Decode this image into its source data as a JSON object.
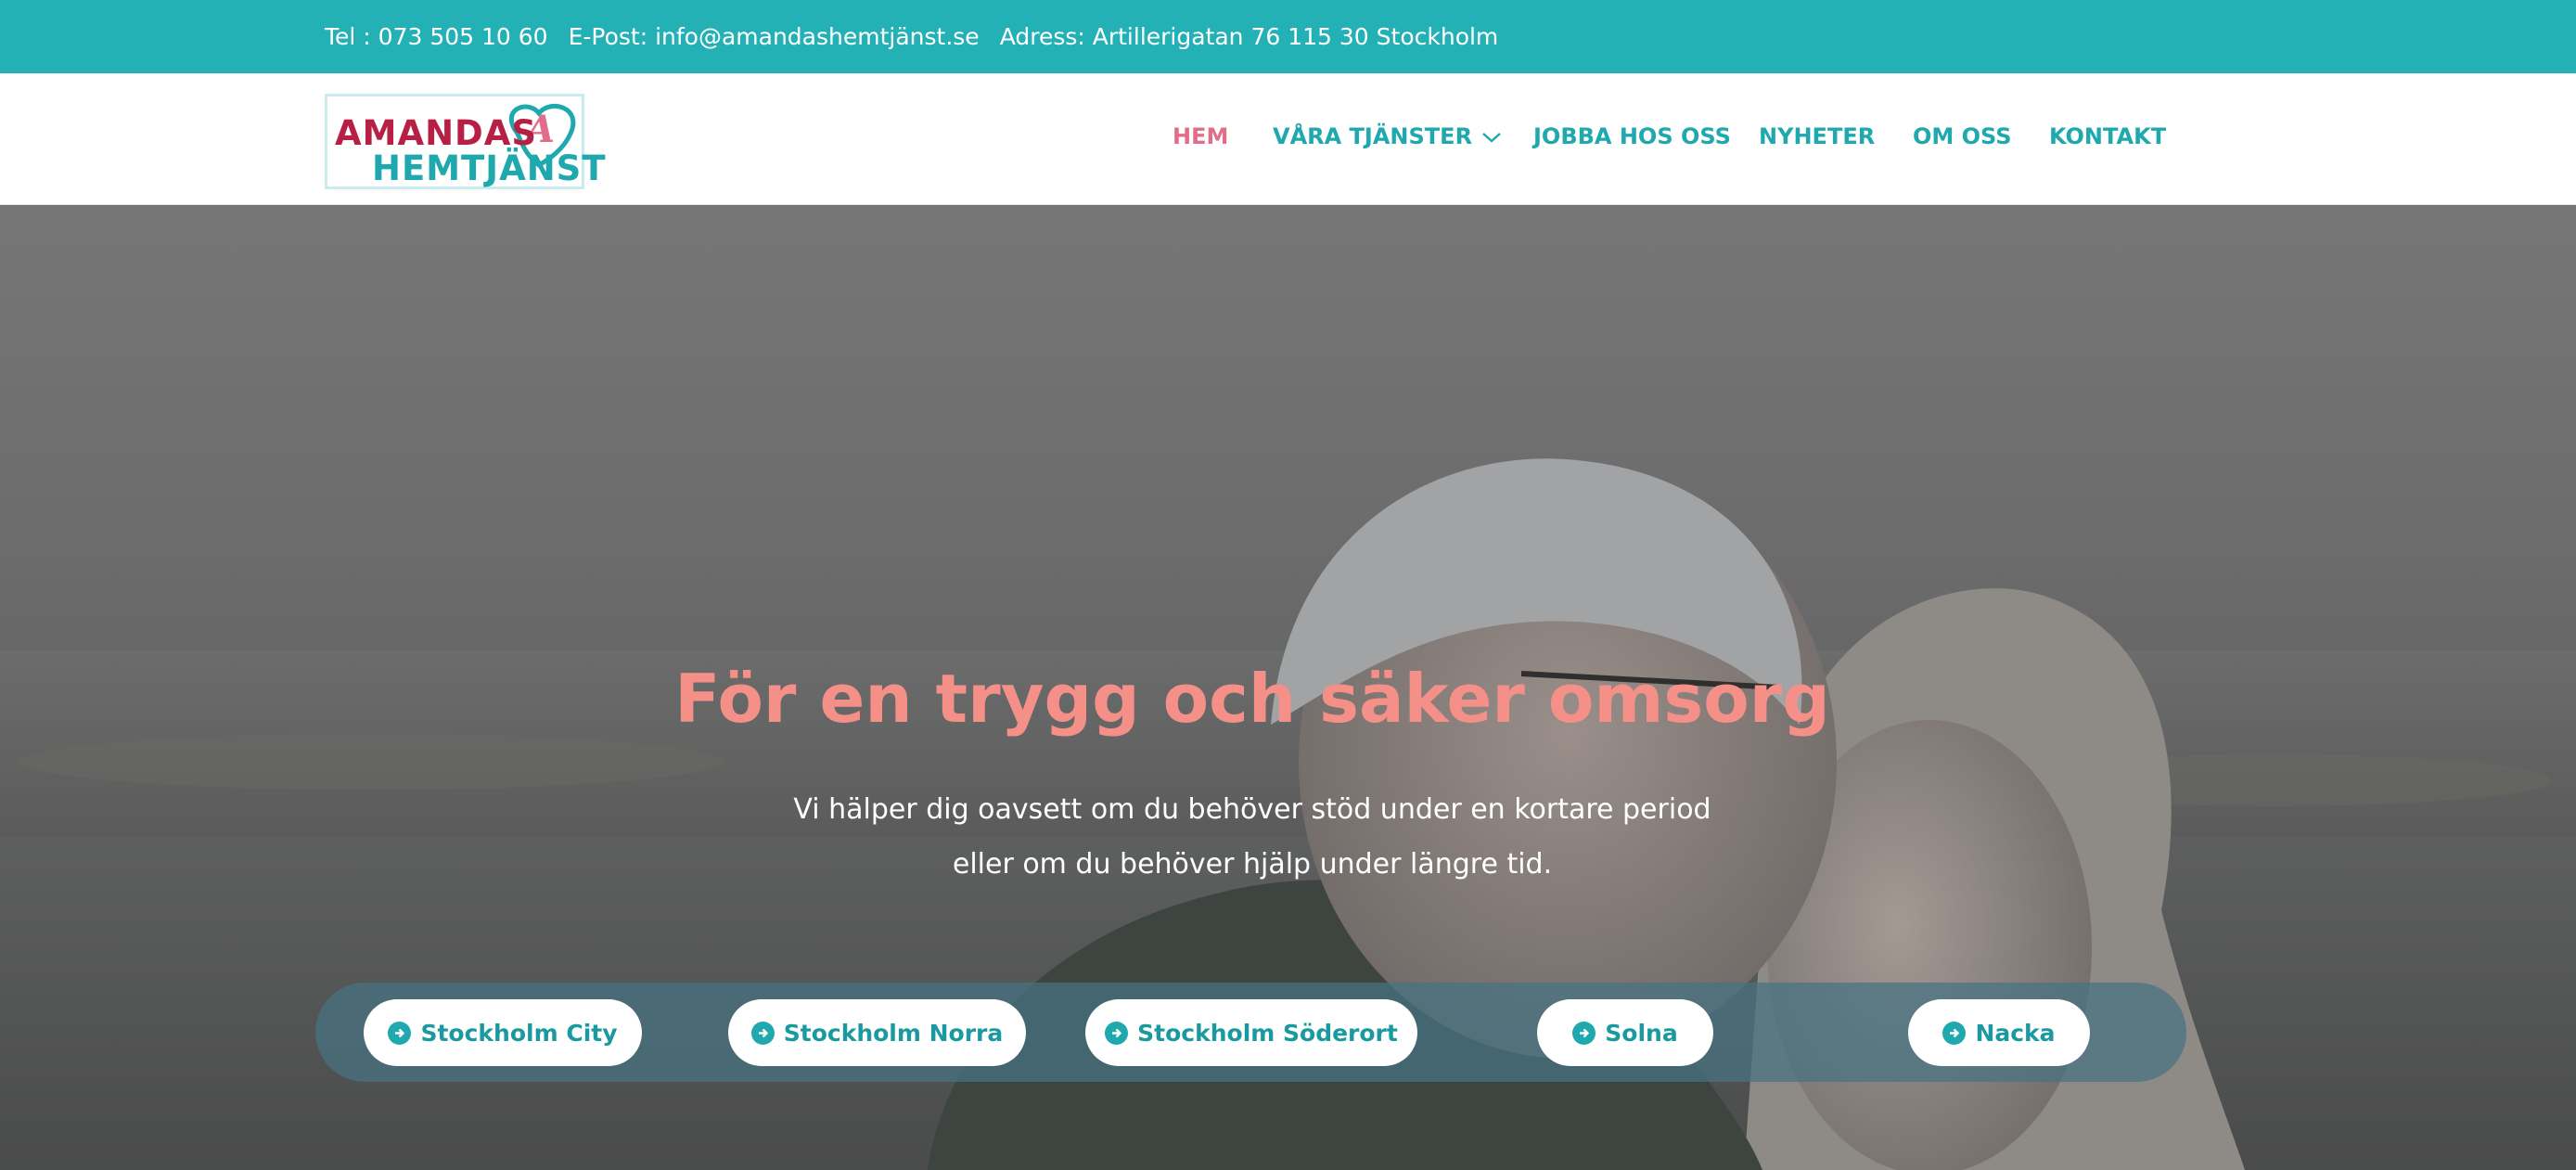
{
  "topbar": {
    "phone": "Tel : 073 505 10 60",
    "email": "E-Post: info@amandashemtjänst.se",
    "address": "Adress: Artillerigatan 76 115 30 Stockholm"
  },
  "logo": {
    "line1": "AMANDAS",
    "line2": "HEMTJÄNST",
    "monogram": "A"
  },
  "nav": {
    "items": [
      {
        "label": "HEM",
        "active": true
      },
      {
        "label": "VÅRA TJÄNSTER",
        "has_dropdown": true
      },
      {
        "label": "JOBBA HOS OSS"
      },
      {
        "label": "NYHETER"
      },
      {
        "label": "OM OSS"
      },
      {
        "label": "KONTAKT"
      }
    ]
  },
  "hero": {
    "title": "För en trygg och säker omsorg",
    "subtitle_line1": "Vi hälper dig oavsett om du behöver stöd under en kortare period",
    "subtitle_line2": "eller om du behöver hjälp under längre tid."
  },
  "areas": [
    {
      "label": "Stockholm City"
    },
    {
      "label": "Stockholm Norra"
    },
    {
      "label": "Stockholm Söderort"
    },
    {
      "label": "Solna"
    },
    {
      "label": "Nacka"
    }
  ],
  "icons": {
    "dropdown": "chevron-down-icon",
    "area_button": "arrow-circle-right-icon",
    "logo_mark": "heart-icon"
  },
  "colors": {
    "brand_teal": "#24b1b5",
    "brand_red": "#b81f45",
    "active_nav": "#e26d8b",
    "hero_title": "#f59089"
  }
}
